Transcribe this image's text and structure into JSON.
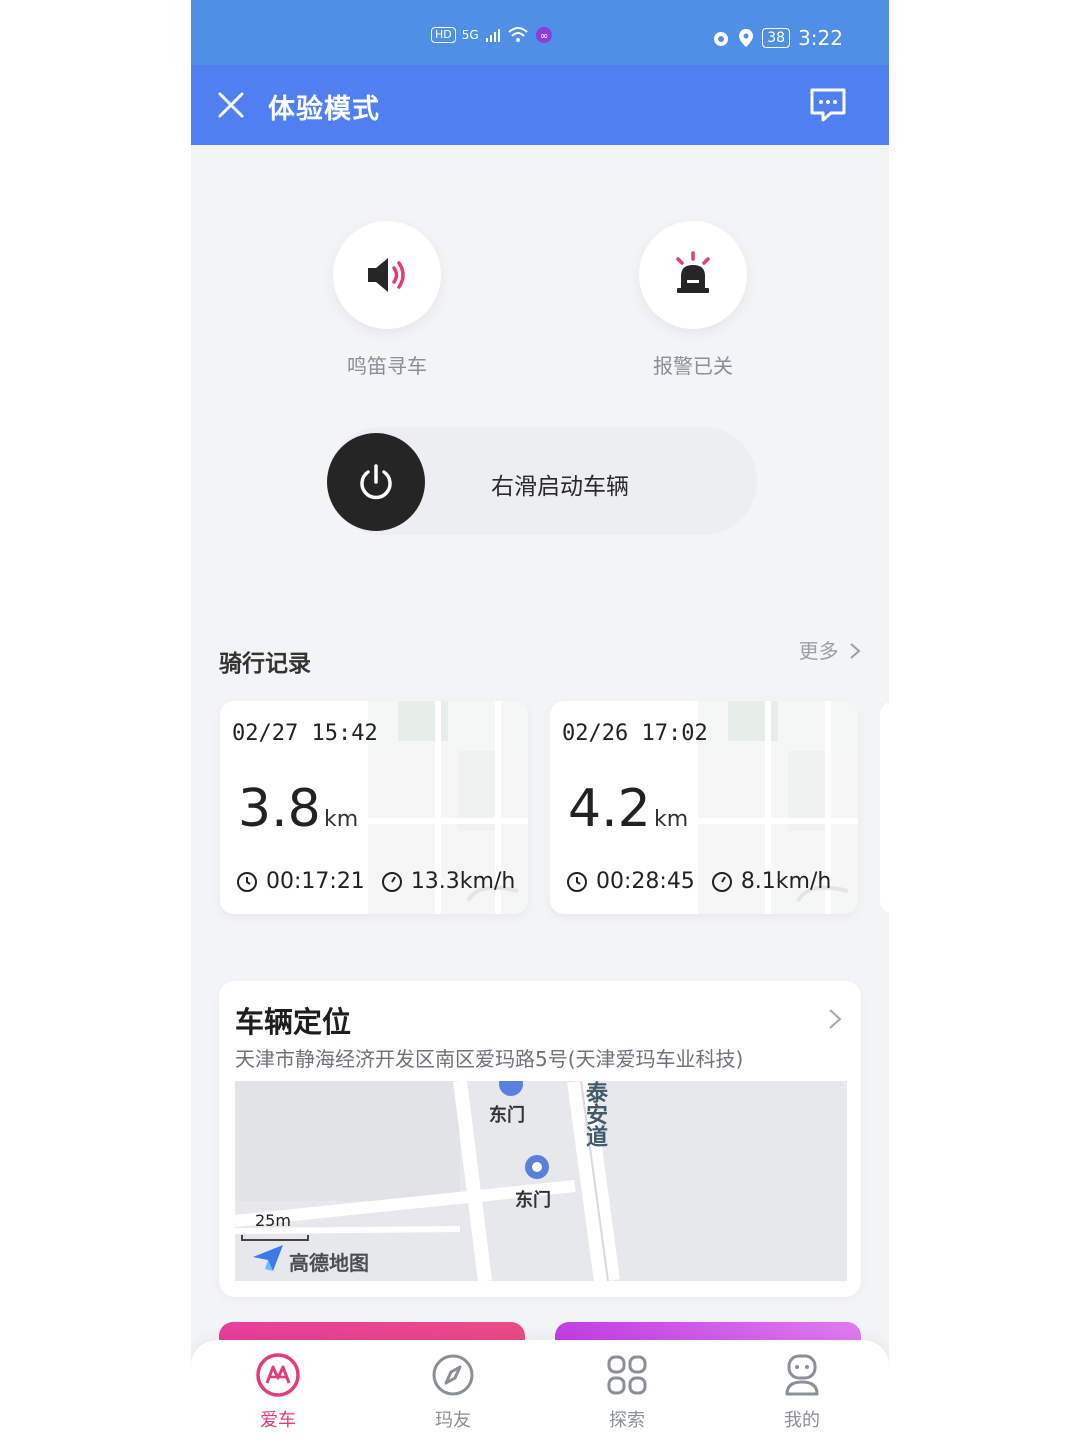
{
  "status_bar": {
    "left_badges": [
      "HD",
      "5G"
    ],
    "battery": "38",
    "time": "3:22"
  },
  "app_bar": {
    "title": "体验模式"
  },
  "controls": {
    "horn_label": "鸣笛寻车",
    "alarm_label": "报警已关",
    "slider_label": "右滑启动车辆"
  },
  "rides": {
    "section_title": "骑行记录",
    "more_label": "更多",
    "items": [
      {
        "date": "02/27 15:42",
        "distance": "3.8",
        "unit": "km",
        "duration": "00:17:21",
        "speed": "13.3km/h"
      },
      {
        "date": "02/26 17:02",
        "distance": "4.2",
        "unit": "km",
        "duration": "00:28:45",
        "speed": "8.1km/h"
      }
    ]
  },
  "location": {
    "title": "车辆定位",
    "address": "天津市静海经济开发区南区爱玛路5号(天津爱玛车业科技)",
    "map": {
      "poi_1": "东门",
      "poi_2": "东门",
      "road": "泰安道",
      "scale": "25m",
      "provider": "高德地图"
    }
  },
  "tabs": [
    {
      "label": "爱车",
      "active": true,
      "icon": "aima-logo-icon"
    },
    {
      "label": "玛友",
      "active": false,
      "icon": "compass-icon"
    },
    {
      "label": "探索",
      "active": false,
      "icon": "grid-icon"
    },
    {
      "label": "我的",
      "active": false,
      "icon": "robot-user-icon"
    }
  ],
  "colors": {
    "status_bar": "#4f8fe6",
    "app_bar": "#4f7ff0",
    "accent_pink": "#e23c7a",
    "tab_inactive": "#8b8f96"
  }
}
